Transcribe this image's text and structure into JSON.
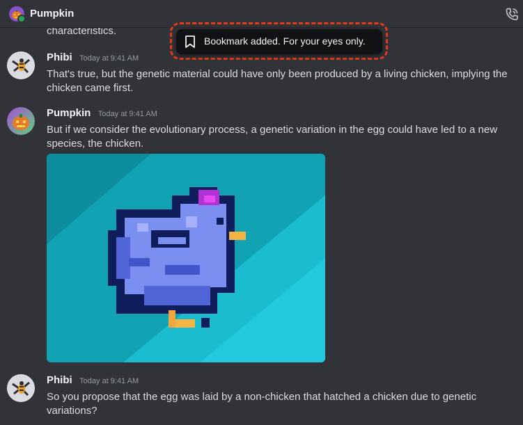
{
  "header": {
    "title": "Pumpkin",
    "status": "online",
    "call_icon": "phone-call-icon"
  },
  "toast": {
    "icon": "bookmark-icon",
    "text": "Bookmark added. For your eyes only."
  },
  "messages": {
    "cut_off_text": "characteristics.",
    "items": [
      {
        "author": "Phibi",
        "time": "Today at 9:41 AM",
        "text": "That's true, but the genetic material could have only been produced by a living chicken, implying the chicken came first."
      },
      {
        "author": "Pumpkin",
        "time": "Today at 9:41 AM",
        "text": "But if we consider the evolutionary process, a genetic variation in the egg could have led to a new species, the chicken.",
        "attachment": "pixel-art chicken image"
      },
      {
        "author": "Phibi",
        "time": "Today at 9:41 AM",
        "text": "So you propose that the egg was laid by a non-chicken that hatched a chicken due to genetic variations?"
      }
    ]
  },
  "colors": {
    "background": "#313338",
    "toast_bg": "#111214",
    "highlight": "#e8391a",
    "online": "#23a55a",
    "attachment_bg": "#11a3b4"
  }
}
